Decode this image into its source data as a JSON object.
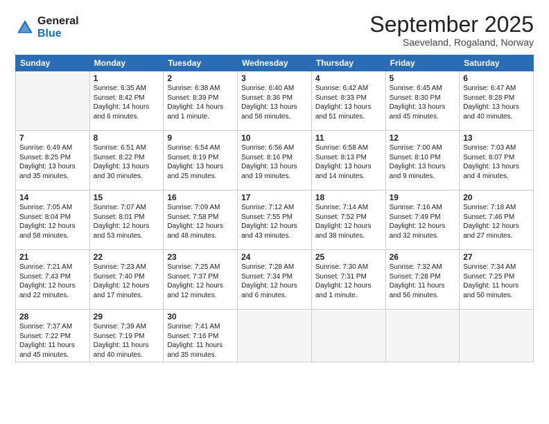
{
  "logo": {
    "general": "General",
    "blue": "Blue"
  },
  "header": {
    "month": "September 2025",
    "location": "Saeveland, Rogaland, Norway"
  },
  "weekdays": [
    "Sunday",
    "Monday",
    "Tuesday",
    "Wednesday",
    "Thursday",
    "Friday",
    "Saturday"
  ],
  "weeks": [
    [
      {
        "day": "",
        "info": ""
      },
      {
        "day": "1",
        "info": "Sunrise: 6:35 AM\nSunset: 8:42 PM\nDaylight: 14 hours\nand 6 minutes."
      },
      {
        "day": "2",
        "info": "Sunrise: 6:38 AM\nSunset: 8:39 PM\nDaylight: 14 hours\nand 1 minute."
      },
      {
        "day": "3",
        "info": "Sunrise: 6:40 AM\nSunset: 8:36 PM\nDaylight: 13 hours\nand 56 minutes."
      },
      {
        "day": "4",
        "info": "Sunrise: 6:42 AM\nSunset: 8:33 PM\nDaylight: 13 hours\nand 51 minutes."
      },
      {
        "day": "5",
        "info": "Sunrise: 6:45 AM\nSunset: 8:30 PM\nDaylight: 13 hours\nand 45 minutes."
      },
      {
        "day": "6",
        "info": "Sunrise: 6:47 AM\nSunset: 8:28 PM\nDaylight: 13 hours\nand 40 minutes."
      }
    ],
    [
      {
        "day": "7",
        "info": "Sunrise: 6:49 AM\nSunset: 8:25 PM\nDaylight: 13 hours\nand 35 minutes."
      },
      {
        "day": "8",
        "info": "Sunrise: 6:51 AM\nSunset: 8:22 PM\nDaylight: 13 hours\nand 30 minutes."
      },
      {
        "day": "9",
        "info": "Sunrise: 6:54 AM\nSunset: 8:19 PM\nDaylight: 13 hours\nand 25 minutes."
      },
      {
        "day": "10",
        "info": "Sunrise: 6:56 AM\nSunset: 8:16 PM\nDaylight: 13 hours\nand 19 minutes."
      },
      {
        "day": "11",
        "info": "Sunrise: 6:58 AM\nSunset: 8:13 PM\nDaylight: 13 hours\nand 14 minutes."
      },
      {
        "day": "12",
        "info": "Sunrise: 7:00 AM\nSunset: 8:10 PM\nDaylight: 13 hours\nand 9 minutes."
      },
      {
        "day": "13",
        "info": "Sunrise: 7:03 AM\nSunset: 8:07 PM\nDaylight: 13 hours\nand 4 minutes."
      }
    ],
    [
      {
        "day": "14",
        "info": "Sunrise: 7:05 AM\nSunset: 8:04 PM\nDaylight: 12 hours\nand 58 minutes."
      },
      {
        "day": "15",
        "info": "Sunrise: 7:07 AM\nSunset: 8:01 PM\nDaylight: 12 hours\nand 53 minutes."
      },
      {
        "day": "16",
        "info": "Sunrise: 7:09 AM\nSunset: 7:58 PM\nDaylight: 12 hours\nand 48 minutes."
      },
      {
        "day": "17",
        "info": "Sunrise: 7:12 AM\nSunset: 7:55 PM\nDaylight: 12 hours\nand 43 minutes."
      },
      {
        "day": "18",
        "info": "Sunrise: 7:14 AM\nSunset: 7:52 PM\nDaylight: 12 hours\nand 38 minutes."
      },
      {
        "day": "19",
        "info": "Sunrise: 7:16 AM\nSunset: 7:49 PM\nDaylight: 12 hours\nand 32 minutes."
      },
      {
        "day": "20",
        "info": "Sunrise: 7:18 AM\nSunset: 7:46 PM\nDaylight: 12 hours\nand 27 minutes."
      }
    ],
    [
      {
        "day": "21",
        "info": "Sunrise: 7:21 AM\nSunset: 7:43 PM\nDaylight: 12 hours\nand 22 minutes."
      },
      {
        "day": "22",
        "info": "Sunrise: 7:23 AM\nSunset: 7:40 PM\nDaylight: 12 hours\nand 17 minutes."
      },
      {
        "day": "23",
        "info": "Sunrise: 7:25 AM\nSunset: 7:37 PM\nDaylight: 12 hours\nand 12 minutes."
      },
      {
        "day": "24",
        "info": "Sunrise: 7:28 AM\nSunset: 7:34 PM\nDaylight: 12 hours\nand 6 minutes."
      },
      {
        "day": "25",
        "info": "Sunrise: 7:30 AM\nSunset: 7:31 PM\nDaylight: 12 hours\nand 1 minute."
      },
      {
        "day": "26",
        "info": "Sunrise: 7:32 AM\nSunset: 7:28 PM\nDaylight: 11 hours\nand 56 minutes."
      },
      {
        "day": "27",
        "info": "Sunrise: 7:34 AM\nSunset: 7:25 PM\nDaylight: 11 hours\nand 50 minutes."
      }
    ],
    [
      {
        "day": "28",
        "info": "Sunrise: 7:37 AM\nSunset: 7:22 PM\nDaylight: 11 hours\nand 45 minutes."
      },
      {
        "day": "29",
        "info": "Sunrise: 7:39 AM\nSunset: 7:19 PM\nDaylight: 11 hours\nand 40 minutes."
      },
      {
        "day": "30",
        "info": "Sunrise: 7:41 AM\nSunset: 7:16 PM\nDaylight: 11 hours\nand 35 minutes."
      },
      {
        "day": "",
        "info": ""
      },
      {
        "day": "",
        "info": ""
      },
      {
        "day": "",
        "info": ""
      },
      {
        "day": "",
        "info": ""
      }
    ]
  ]
}
